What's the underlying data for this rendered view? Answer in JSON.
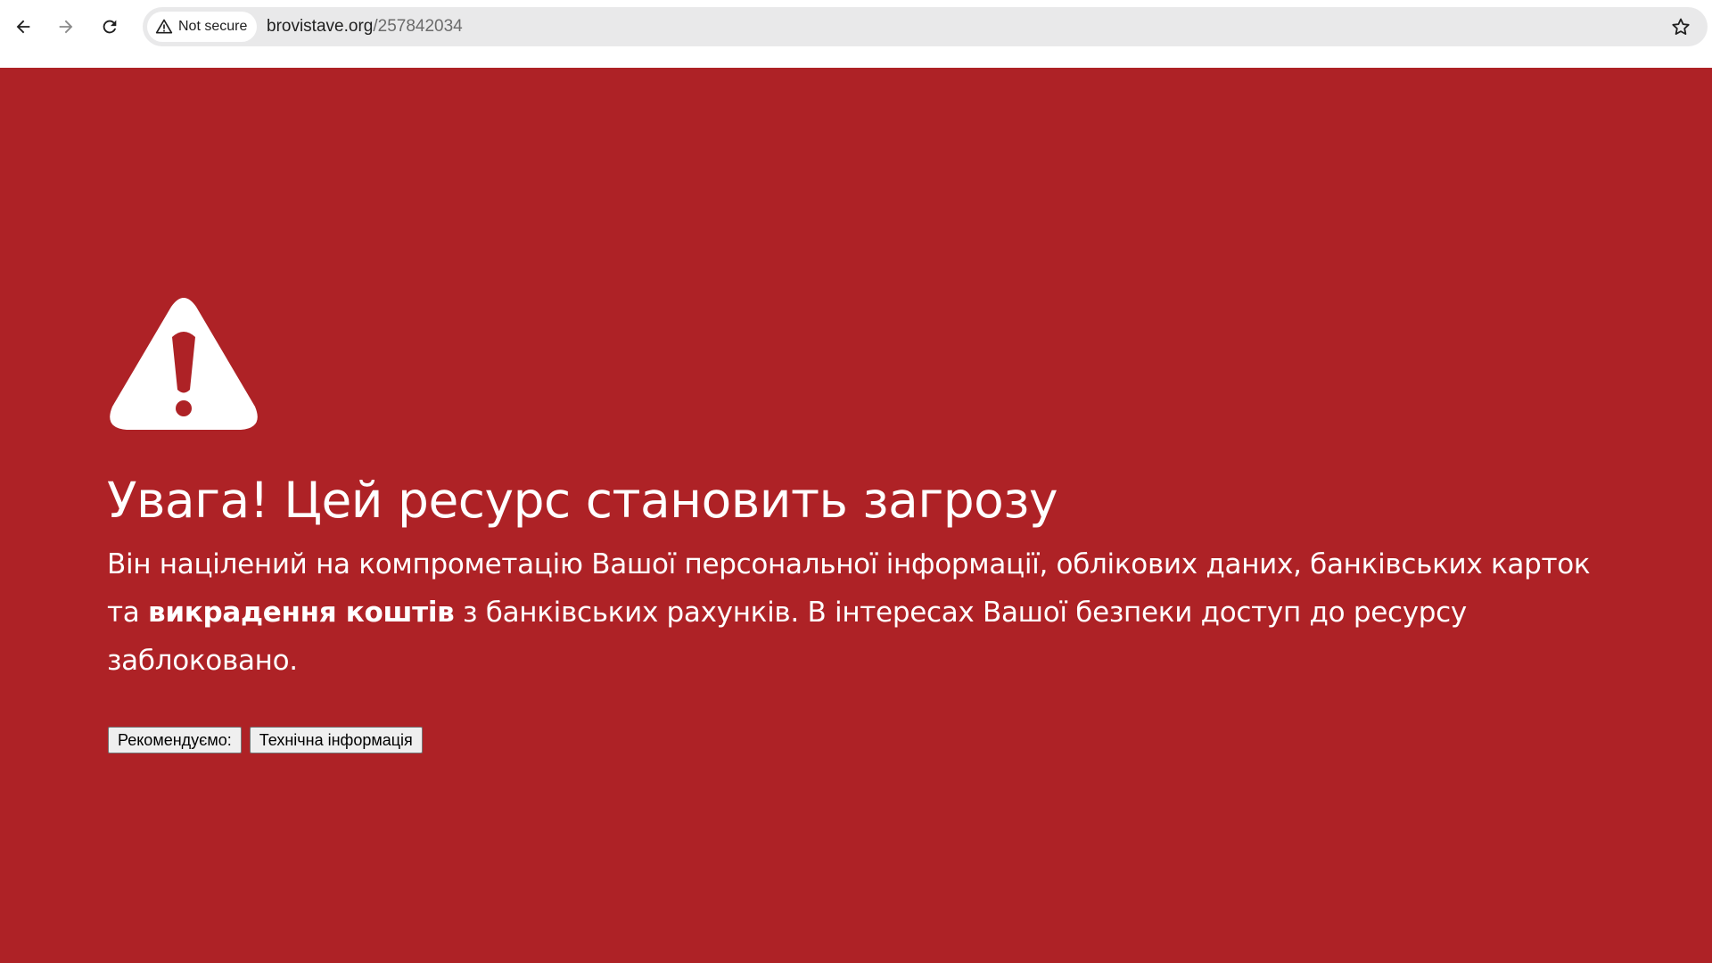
{
  "browser": {
    "security_label": "Not secure",
    "url_host": "brovistave.org",
    "url_path": "/257842034"
  },
  "warning": {
    "title": "Увага! Цей ресурс становить загрозу",
    "text_part1": "Він націлений на компрометацію Вашої персональної інформації, облікових даних, банківських карток та ",
    "text_bold": "викрадення коштів",
    "text_part2": " з банківських рахунків. В інтересах Вашої безпеки доступ до ресурсу заблоковано.",
    "buttons": {
      "recommend_label": "Рекомендуємо:",
      "tech_info_label": "Технічна інформація"
    }
  },
  "colors": {
    "page_background": "#ae2226",
    "omnibox_background": "#e9e9ea",
    "text": "#ffffff"
  },
  "icons": {
    "back": "back-arrow-icon",
    "forward": "forward-arrow-icon",
    "reload": "reload-icon",
    "security": "warning-triangle-icon",
    "bookmark": "star-icon",
    "page_warning": "warning-triangle-icon"
  }
}
